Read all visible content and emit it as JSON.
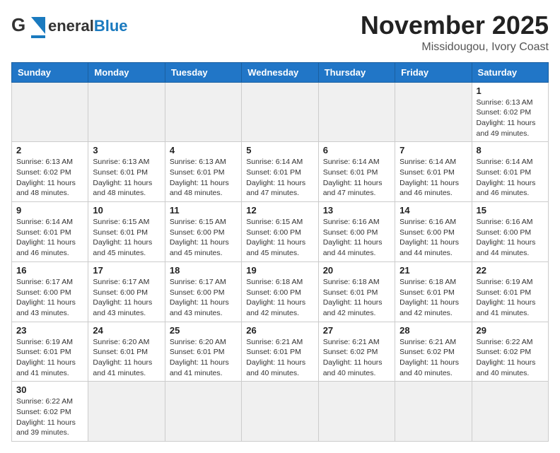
{
  "header": {
    "logo_general": "General",
    "logo_blue": "Blue",
    "month_title": "November 2025",
    "location": "Missidougou, Ivory Coast"
  },
  "days_of_week": [
    "Sunday",
    "Monday",
    "Tuesday",
    "Wednesday",
    "Thursday",
    "Friday",
    "Saturday"
  ],
  "weeks": [
    [
      {
        "day": "",
        "info": ""
      },
      {
        "day": "",
        "info": ""
      },
      {
        "day": "",
        "info": ""
      },
      {
        "day": "",
        "info": ""
      },
      {
        "day": "",
        "info": ""
      },
      {
        "day": "",
        "info": ""
      },
      {
        "day": "1",
        "info": "Sunrise: 6:13 AM\nSunset: 6:02 PM\nDaylight: 11 hours\nand 49 minutes."
      }
    ],
    [
      {
        "day": "2",
        "info": "Sunrise: 6:13 AM\nSunset: 6:02 PM\nDaylight: 11 hours\nand 48 minutes."
      },
      {
        "day": "3",
        "info": "Sunrise: 6:13 AM\nSunset: 6:01 PM\nDaylight: 11 hours\nand 48 minutes."
      },
      {
        "day": "4",
        "info": "Sunrise: 6:13 AM\nSunset: 6:01 PM\nDaylight: 11 hours\nand 48 minutes."
      },
      {
        "day": "5",
        "info": "Sunrise: 6:14 AM\nSunset: 6:01 PM\nDaylight: 11 hours\nand 47 minutes."
      },
      {
        "day": "6",
        "info": "Sunrise: 6:14 AM\nSunset: 6:01 PM\nDaylight: 11 hours\nand 47 minutes."
      },
      {
        "day": "7",
        "info": "Sunrise: 6:14 AM\nSunset: 6:01 PM\nDaylight: 11 hours\nand 46 minutes."
      },
      {
        "day": "8",
        "info": "Sunrise: 6:14 AM\nSunset: 6:01 PM\nDaylight: 11 hours\nand 46 minutes."
      }
    ],
    [
      {
        "day": "9",
        "info": "Sunrise: 6:14 AM\nSunset: 6:01 PM\nDaylight: 11 hours\nand 46 minutes."
      },
      {
        "day": "10",
        "info": "Sunrise: 6:15 AM\nSunset: 6:01 PM\nDaylight: 11 hours\nand 45 minutes."
      },
      {
        "day": "11",
        "info": "Sunrise: 6:15 AM\nSunset: 6:00 PM\nDaylight: 11 hours\nand 45 minutes."
      },
      {
        "day": "12",
        "info": "Sunrise: 6:15 AM\nSunset: 6:00 PM\nDaylight: 11 hours\nand 45 minutes."
      },
      {
        "day": "13",
        "info": "Sunrise: 6:16 AM\nSunset: 6:00 PM\nDaylight: 11 hours\nand 44 minutes."
      },
      {
        "day": "14",
        "info": "Sunrise: 6:16 AM\nSunset: 6:00 PM\nDaylight: 11 hours\nand 44 minutes."
      },
      {
        "day": "15",
        "info": "Sunrise: 6:16 AM\nSunset: 6:00 PM\nDaylight: 11 hours\nand 44 minutes."
      }
    ],
    [
      {
        "day": "16",
        "info": "Sunrise: 6:17 AM\nSunset: 6:00 PM\nDaylight: 11 hours\nand 43 minutes."
      },
      {
        "day": "17",
        "info": "Sunrise: 6:17 AM\nSunset: 6:00 PM\nDaylight: 11 hours\nand 43 minutes."
      },
      {
        "day": "18",
        "info": "Sunrise: 6:17 AM\nSunset: 6:00 PM\nDaylight: 11 hours\nand 43 minutes."
      },
      {
        "day": "19",
        "info": "Sunrise: 6:18 AM\nSunset: 6:00 PM\nDaylight: 11 hours\nand 42 minutes."
      },
      {
        "day": "20",
        "info": "Sunrise: 6:18 AM\nSunset: 6:01 PM\nDaylight: 11 hours\nand 42 minutes."
      },
      {
        "day": "21",
        "info": "Sunrise: 6:18 AM\nSunset: 6:01 PM\nDaylight: 11 hours\nand 42 minutes."
      },
      {
        "day": "22",
        "info": "Sunrise: 6:19 AM\nSunset: 6:01 PM\nDaylight: 11 hours\nand 41 minutes."
      }
    ],
    [
      {
        "day": "23",
        "info": "Sunrise: 6:19 AM\nSunset: 6:01 PM\nDaylight: 11 hours\nand 41 minutes."
      },
      {
        "day": "24",
        "info": "Sunrise: 6:20 AM\nSunset: 6:01 PM\nDaylight: 11 hours\nand 41 minutes."
      },
      {
        "day": "25",
        "info": "Sunrise: 6:20 AM\nSunset: 6:01 PM\nDaylight: 11 hours\nand 41 minutes."
      },
      {
        "day": "26",
        "info": "Sunrise: 6:21 AM\nSunset: 6:01 PM\nDaylight: 11 hours\nand 40 minutes."
      },
      {
        "day": "27",
        "info": "Sunrise: 6:21 AM\nSunset: 6:02 PM\nDaylight: 11 hours\nand 40 minutes."
      },
      {
        "day": "28",
        "info": "Sunrise: 6:21 AM\nSunset: 6:02 PM\nDaylight: 11 hours\nand 40 minutes."
      },
      {
        "day": "29",
        "info": "Sunrise: 6:22 AM\nSunset: 6:02 PM\nDaylight: 11 hours\nand 40 minutes."
      }
    ],
    [
      {
        "day": "30",
        "info": "Sunrise: 6:22 AM\nSunset: 6:02 PM\nDaylight: 11 hours\nand 39 minutes."
      },
      {
        "day": "",
        "info": ""
      },
      {
        "day": "",
        "info": ""
      },
      {
        "day": "",
        "info": ""
      },
      {
        "day": "",
        "info": ""
      },
      {
        "day": "",
        "info": ""
      },
      {
        "day": "",
        "info": ""
      }
    ]
  ]
}
